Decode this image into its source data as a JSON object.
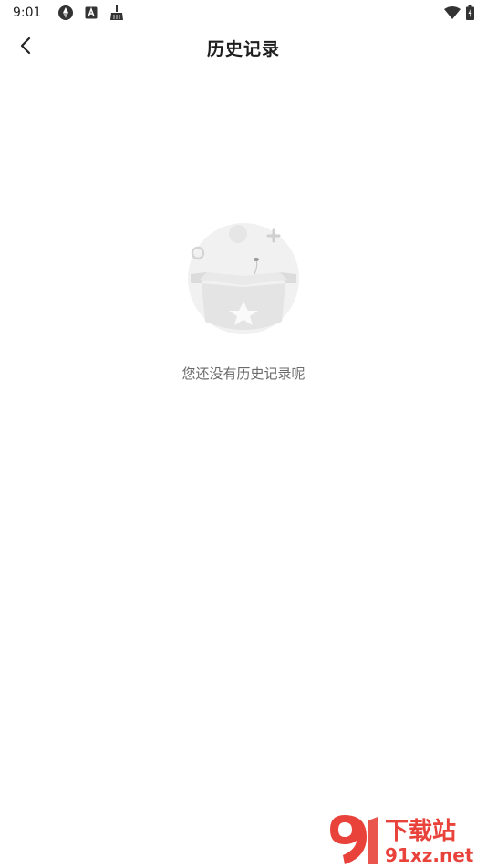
{
  "status_bar": {
    "time": "9:01",
    "left_icons": [
      "aperture-icon",
      "a-box-icon",
      "broom-icon"
    ],
    "right_icons": [
      "wifi-icon",
      "battery-charging-icon"
    ]
  },
  "header": {
    "title": "历史记录",
    "back_icon": "chevron-left-icon"
  },
  "empty_state": {
    "illustration": "empty-box-icon",
    "message": "您还没有历史记录呢"
  },
  "watermark": {
    "line1": "下载站",
    "line2": "91xz.net",
    "logo_text": "9"
  },
  "colors": {
    "background": "#ffffff",
    "title": "#1e1e1e",
    "muted_text": "#6b6b6b",
    "watermark_red": "#e8423b"
  }
}
